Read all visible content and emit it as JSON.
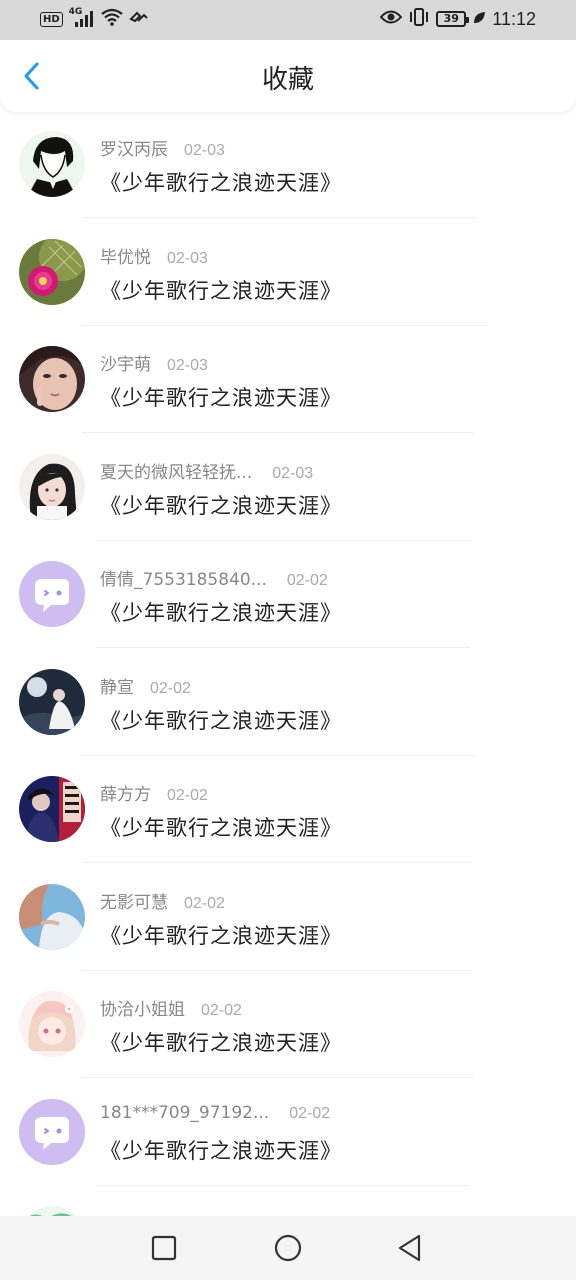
{
  "status_bar": {
    "hd": "HD",
    "network": "4G",
    "battery": "39",
    "time": "11:12",
    "icons": [
      "signal-icon",
      "wifi-icon",
      "link-icon",
      "eye-icon",
      "vibrate-icon",
      "leaf-icon"
    ]
  },
  "header": {
    "title": "收藏",
    "back_icon": "chevron-left-icon",
    "accent_color": "#2196f3"
  },
  "items": [
    {
      "name": "罗汉丙辰",
      "date": "02-03",
      "title": "《少年歌行之浪迹天涯》",
      "avatar": "sketch-boy"
    },
    {
      "name": "毕优悦",
      "date": "02-03",
      "title": "《少年歌行之浪迹天涯》",
      "avatar": "cactus-flower"
    },
    {
      "name": "沙宇萌",
      "date": "02-03",
      "title": "《少年歌行之浪迹天涯》",
      "avatar": "girl-selfie"
    },
    {
      "name": "夏天的微风轻轻抚...",
      "date": "02-03",
      "title": "《少年歌行之浪迹天涯》",
      "avatar": "girl-dark-hair"
    },
    {
      "name": "倩倩_7553185840...",
      "date": "02-02",
      "title": "《少年歌行之浪迹天涯》",
      "avatar": "default-chat"
    },
    {
      "name": "静宣",
      "date": "02-02",
      "title": "《少年歌行之浪迹天涯》",
      "avatar": "night-girl"
    },
    {
      "name": "薛方方",
      "date": "02-02",
      "title": "《少年歌行之浪迹天涯》",
      "avatar": "dark-poster"
    },
    {
      "name": "无影可慧",
      "date": "02-02",
      "title": "《少年歌行之浪迹天涯》",
      "avatar": "blue-photo"
    },
    {
      "name": "协洽小姐姐",
      "date": "02-02",
      "title": "《少年歌行之浪迹天涯》",
      "avatar": "anime-girl"
    },
    {
      "name": "181***709_97192...",
      "date": "02-02",
      "title": "《少年歌行之浪迹天涯》",
      "avatar": "default-chat"
    },
    {
      "name": "",
      "date": "",
      "title": "",
      "avatar": "partial"
    }
  ],
  "nav_bar": {
    "icons": [
      "recent-apps-icon",
      "home-icon",
      "back-triangle-icon"
    ]
  }
}
